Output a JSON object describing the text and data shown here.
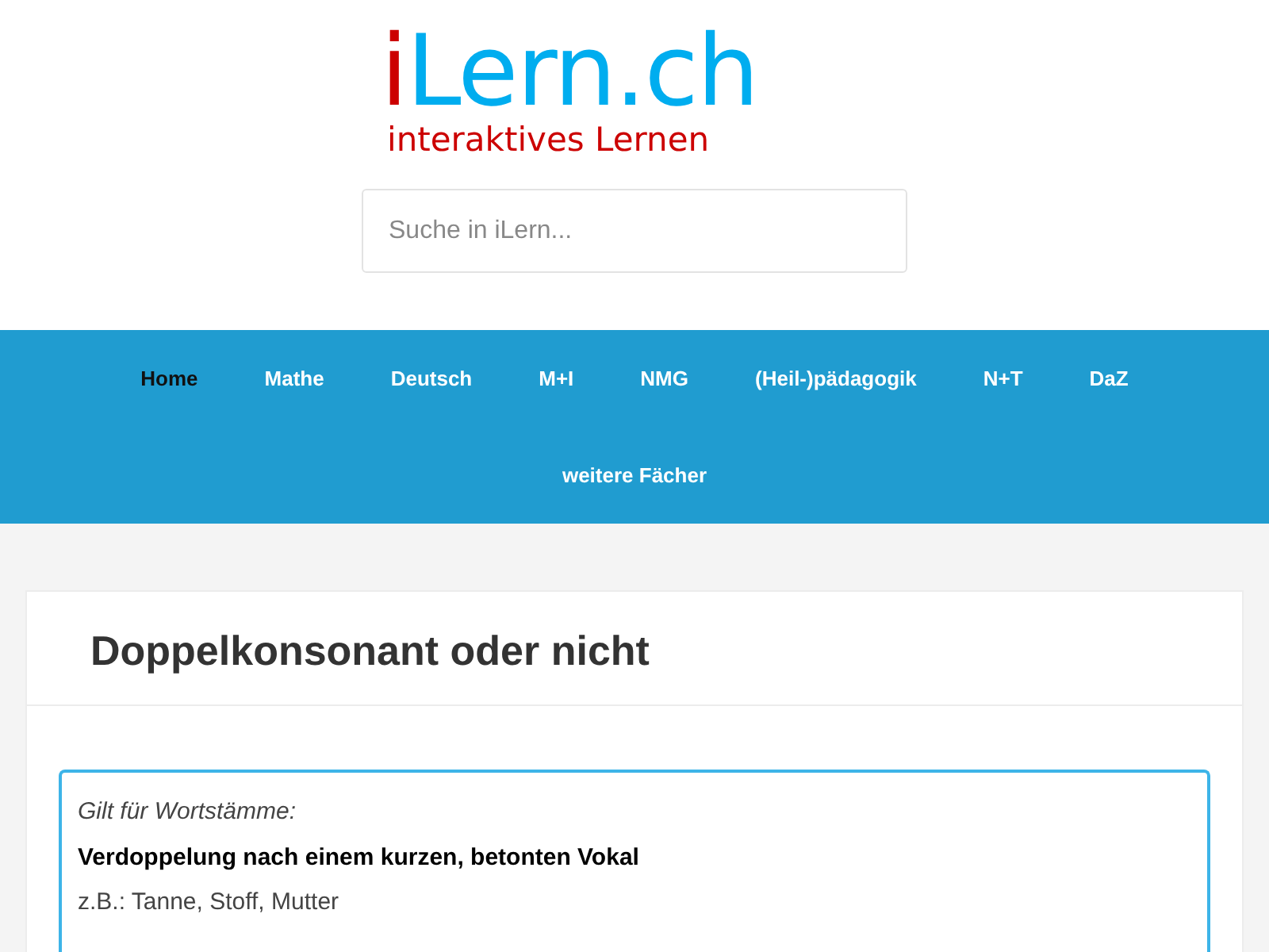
{
  "logo": {
    "accent": "i",
    "name": "Lern.ch",
    "tagline": "interaktives Lernen"
  },
  "search": {
    "placeholder": "Suche in iLern..."
  },
  "nav": [
    {
      "label": "Home",
      "selected": true
    },
    {
      "label": "Mathe",
      "selected": false
    },
    {
      "label": "Deutsch",
      "selected": false
    },
    {
      "label": "M+I",
      "selected": false
    },
    {
      "label": "NMG",
      "selected": false
    },
    {
      "label": "(Heil-)pädagogik",
      "selected": false
    },
    {
      "label": "N+T",
      "selected": false
    },
    {
      "label": "DaZ",
      "selected": false
    },
    {
      "label": "weitere Fächer",
      "selected": false
    }
  ],
  "article": {
    "title": "Doppelkonsonant oder nicht",
    "rule_box": {
      "intro": "Gilt für Wortstämme:",
      "rule": "Verdoppelung nach einem kurzen, betonten Vokal",
      "example": "z.B.: Tanne, Stoff, Mutter"
    }
  }
}
